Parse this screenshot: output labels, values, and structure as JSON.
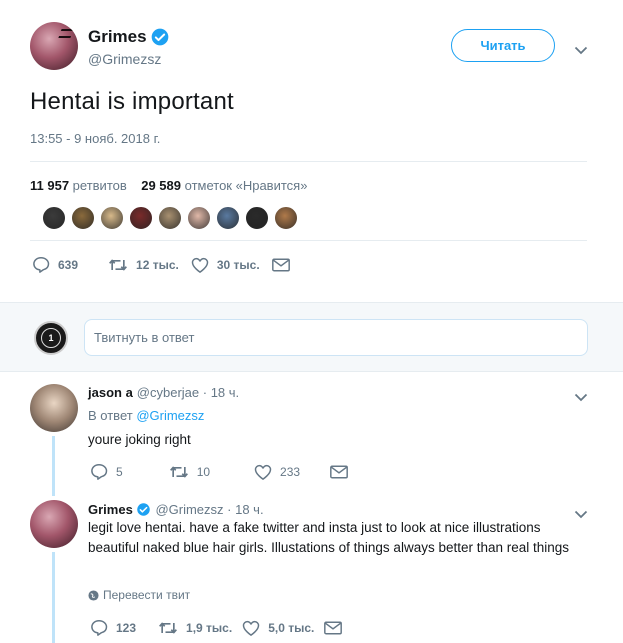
{
  "main_tweet": {
    "author_name": "Grimes",
    "author_handle": "@Grimezsz",
    "follow_label": "Читать",
    "text": "Hentai is important",
    "timestamp": "13:55 - 9 нояб. 2018 г.",
    "retweet_count": "11 957",
    "retweet_label": "ретвитов",
    "like_count": "29 589",
    "like_label": "отметок «Нравится»",
    "likers_colors": [
      "#3b3b3b",
      "#8a6a3c",
      "#d7b98a",
      "#7a2a2a",
      "#a89070",
      "#e0b8a8",
      "#5a7aa0",
      "#2a2a2a",
      "#b07a4a"
    ],
    "actions": {
      "replies": "639",
      "retweets": "12 тыс.",
      "likes": "30 тыс."
    }
  },
  "reply_box": {
    "placeholder": "Твитнуть в ответ",
    "avatar_text": "1"
  },
  "replies": [
    {
      "name": "jason a",
      "handle": "@cyberjae",
      "time": "· 18 ч.",
      "in_reply_prefix": "В ответ",
      "in_reply_handle": "@Grimezsz",
      "text": "youre joking right",
      "actions": {
        "replies": "5",
        "retweets": "10",
        "likes": "233"
      }
    },
    {
      "name": "Grimes",
      "handle": "@Grimezsz",
      "time": "· 18 ч.",
      "text": "legit love hentai.  have a fake twitter and insta just to look at nice illustrations beautiful naked blue hair girls.  Illustations of things always better than real things",
      "translate_label": "Перевести твит",
      "actions": {
        "replies": "123",
        "retweets": "1,9 тыс.",
        "likes": "5,0 тыс."
      }
    }
  ],
  "colors": {
    "accent": "#1da1f2",
    "muted": "#657786",
    "text": "#14171a",
    "thread": "#bfe3f9"
  }
}
